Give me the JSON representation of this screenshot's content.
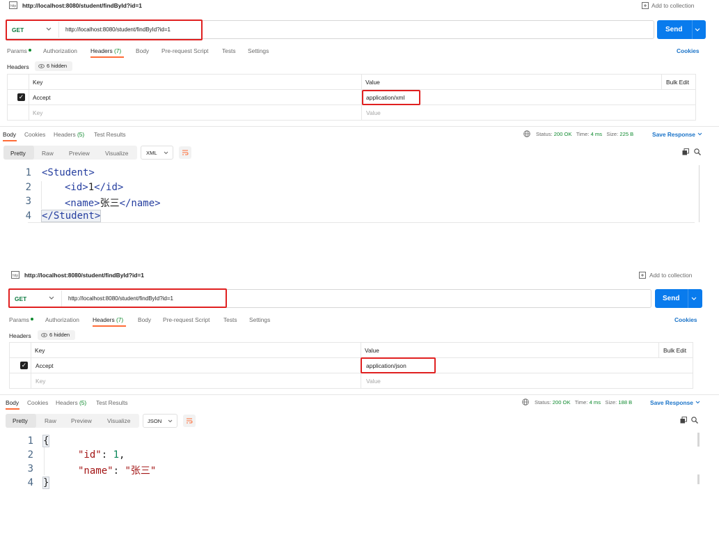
{
  "colors": {
    "accent": "#ff6c37",
    "send": "#097bed",
    "highlight_box": "#e02020",
    "status_ok": "#0f8a2f",
    "link": "#1a73c8"
  },
  "panels": [
    {
      "tab_title": "http://localhost:8080/student/findById?id=1",
      "add_to_collection": "Add to collection",
      "method": "GET",
      "url": "http://localhost:8080/student/findById?id=1",
      "send_label": "Send",
      "req_tabs": [
        "Params",
        "Authorization",
        "Headers",
        "(7)",
        "Body",
        "Pre-request Script",
        "Tests",
        "Settings"
      ],
      "cookies_link": "Cookies",
      "headers_label": "Headers",
      "hidden_label": "6 hidden",
      "table": {
        "key_header": "Key",
        "value_header": "Value",
        "bulk_edit": "Bulk Edit",
        "row_key": "Accept",
        "row_value": "application/xml",
        "key_placeholder": "Key",
        "value_placeholder": "Value"
      },
      "resp_tabs": [
        "Body",
        "Cookies",
        "Headers",
        "(5)",
        "Test Results"
      ],
      "status_label": "Status:",
      "status_value": "200 OK",
      "time_label": "Time:",
      "time_value": "4 ms",
      "size_label": "Size:",
      "size_value": "225 B",
      "save_response": "Save Response",
      "view_modes": [
        "Pretty",
        "Raw",
        "Preview",
        "Visualize"
      ],
      "format": "XML",
      "lines": [
        "1",
        "2",
        "3",
        "4"
      ],
      "code": {
        "l1_open": "<Student>",
        "l2_open": "<id>",
        "l2_val": "1",
        "l2_close": "</id>",
        "l3_open": "<name>",
        "l3_val": "张三",
        "l3_close": "</name>",
        "l4_close": "</Student>"
      }
    },
    {
      "tab_title": "http://localhost:8080/student/findById?id=1",
      "add_to_collection": "Add to collection",
      "method": "GET",
      "url": "http://localhost:8080/student/findById?id=1",
      "send_label": "Send",
      "req_tabs": [
        "Params",
        "Authorization",
        "Headers",
        "(7)",
        "Body",
        "Pre-request Script",
        "Tests",
        "Settings"
      ],
      "cookies_link": "Cookies",
      "headers_label": "Headers",
      "hidden_label": "6 hidden",
      "table": {
        "key_header": "Key",
        "value_header": "Value",
        "bulk_edit": "Bulk Edit",
        "row_key": "Accept",
        "row_value": "application/json",
        "key_placeholder": "Key",
        "value_placeholder": "Value"
      },
      "resp_tabs": [
        "Body",
        "Cookies",
        "Headers",
        "(5)",
        "Test Results"
      ],
      "status_label": "Status:",
      "status_value": "200 OK",
      "time_label": "Time:",
      "time_value": "4 ms",
      "size_label": "Size:",
      "size_value": "188 B",
      "save_response": "Save Response",
      "view_modes": [
        "Pretty",
        "Raw",
        "Preview",
        "Visualize"
      ],
      "format": "JSON",
      "lines": [
        "1",
        "2",
        "3",
        "4"
      ],
      "code": {
        "l1": "{",
        "l2_key": "\"id\"",
        "l2_colon": ": ",
        "l2_val": "1",
        "l2_comma": ",",
        "l3_key": "\"name\"",
        "l3_colon": ": ",
        "l3_val": "\"张三\"",
        "l4": "}"
      }
    }
  ]
}
